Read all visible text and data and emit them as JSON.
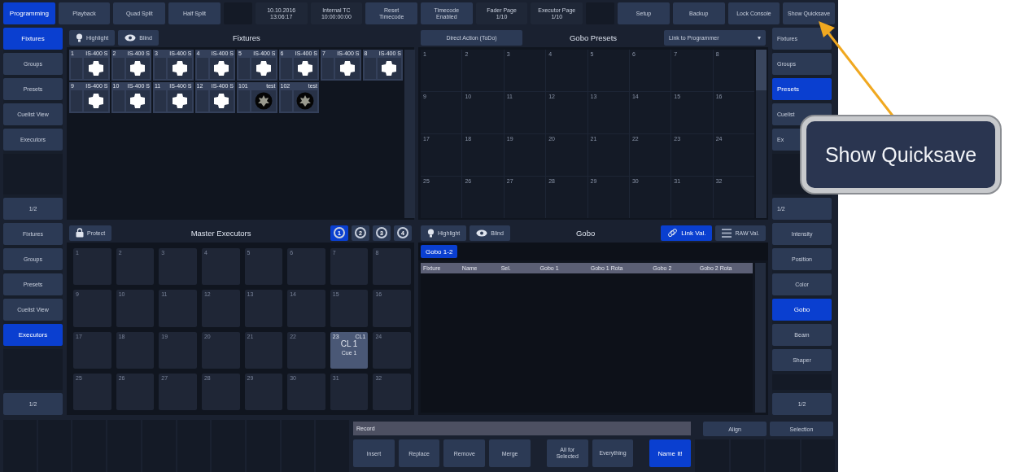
{
  "top_bar": [
    {
      "kind": "button",
      "label": "Programming",
      "selected": true
    },
    {
      "kind": "button",
      "label": "Playback",
      "selected": false
    },
    {
      "kind": "button",
      "label": "Quad Split",
      "selected": false
    },
    {
      "kind": "button",
      "label": "Half Split",
      "selected": false
    },
    {
      "kind": "blank"
    },
    {
      "kind": "info",
      "lines": [
        "10.10.2016",
        "13:06:17"
      ]
    },
    {
      "kind": "info",
      "lines": [
        "Internal TC",
        "10:00:00:00"
      ]
    },
    {
      "kind": "button",
      "lines": [
        "Reset",
        "Timecode"
      ],
      "selected": false
    },
    {
      "kind": "button",
      "lines": [
        "Timecode",
        "Enabled"
      ],
      "selected": false
    },
    {
      "kind": "info",
      "lines": [
        "Fader Page",
        "1/10"
      ]
    },
    {
      "kind": "info",
      "lines": [
        "Executor Page",
        "1/10"
      ]
    },
    {
      "kind": "blank"
    },
    {
      "kind": "button",
      "label": "Setup",
      "selected": false
    },
    {
      "kind": "button",
      "label": "Backup",
      "selected": false
    },
    {
      "kind": "button",
      "label": "Lock Console",
      "selected": false
    },
    {
      "kind": "button",
      "label": "Show Quicksave",
      "selected": false
    }
  ],
  "upper_left_sidebar": {
    "items": [
      {
        "label": "Fixtures",
        "selected": true
      },
      {
        "label": "Groups",
        "selected": false
      },
      {
        "label": "Presets",
        "selected": false
      },
      {
        "label": "Cuelist View",
        "selected": false
      },
      {
        "label": "Executors",
        "selected": false
      }
    ],
    "page": "1/2"
  },
  "fixtures_panel": {
    "title": "Fixtures",
    "highlight": "Highlight",
    "blind": "Blind",
    "fixtures": [
      {
        "number": "1",
        "type": "IS-400 S",
        "kind": "open"
      },
      {
        "number": "2",
        "type": "IS-400 S",
        "kind": "open"
      },
      {
        "number": "3",
        "type": "IS-400 S",
        "kind": "open"
      },
      {
        "number": "4",
        "type": "IS-400 S",
        "kind": "open"
      },
      {
        "number": "5",
        "type": "IS-400 S",
        "kind": "open"
      },
      {
        "number": "6",
        "type": "IS-400 S",
        "kind": "open"
      },
      {
        "number": "7",
        "type": "IS-400 S",
        "kind": "open"
      },
      {
        "number": "8",
        "type": "IS-400 S",
        "kind": "open"
      },
      {
        "number": "9",
        "type": "IS-400 S",
        "kind": "open"
      },
      {
        "number": "10",
        "type": "IS-400 S",
        "kind": "open"
      },
      {
        "number": "11",
        "type": "IS-400 S",
        "kind": "open"
      },
      {
        "number": "12",
        "type": "IS-400 S",
        "kind": "open"
      },
      {
        "number": "101",
        "type": "test",
        "kind": "pattern"
      },
      {
        "number": "102",
        "type": "test",
        "kind": "pattern"
      }
    ]
  },
  "gobo_presets_panel": {
    "title": "Gobo Presets",
    "action": "Direct Action (ToDo)",
    "link_dropdown": "Link to Programmer",
    "caret": "▾",
    "cells": [
      "1",
      "2",
      "3",
      "4",
      "5",
      "6",
      "7",
      "8",
      "9",
      "10",
      "11",
      "12",
      "13",
      "14",
      "15",
      "16",
      "17",
      "18",
      "19",
      "20",
      "21",
      "22",
      "23",
      "24",
      "25",
      "26",
      "27",
      "28",
      "29",
      "30",
      "31",
      "32"
    ]
  },
  "upper_right_sidebar": {
    "items": [
      {
        "label": "Fixtures",
        "selected": false
      },
      {
        "label": "Groups",
        "selected": false
      },
      {
        "label": "Presets",
        "selected": true
      },
      {
        "label": "Cuelist",
        "selected": false
      },
      {
        "label": "Ex",
        "selected": false
      }
    ],
    "page": "1/2"
  },
  "lower_left_sidebar": {
    "items": [
      {
        "label": "Fixtures",
        "selected": false
      },
      {
        "label": "Groups",
        "selected": false
      },
      {
        "label": "Presets",
        "selected": false
      },
      {
        "label": "Cuelist View",
        "selected": false
      },
      {
        "label": "Executors",
        "selected": true
      }
    ],
    "page": "1/2"
  },
  "master_executors_panel": {
    "title": "Master Executors",
    "protect": "Protect",
    "pages": [
      {
        "label": "1",
        "selected": true
      },
      {
        "label": "2",
        "selected": false
      },
      {
        "label": "3",
        "selected": false
      },
      {
        "label": "4",
        "selected": false
      }
    ],
    "executors": [
      {
        "kind": "empty",
        "number": "1"
      },
      {
        "kind": "empty",
        "number": "2"
      },
      {
        "kind": "empty",
        "number": "3"
      },
      {
        "kind": "empty",
        "number": "4"
      },
      {
        "kind": "empty",
        "number": "5"
      },
      {
        "kind": "empty",
        "number": "6"
      },
      {
        "kind": "empty",
        "number": "7"
      },
      {
        "kind": "empty",
        "number": "8"
      },
      {
        "kind": "empty",
        "number": "9"
      },
      {
        "kind": "empty",
        "number": "10"
      },
      {
        "kind": "empty",
        "number": "11"
      },
      {
        "kind": "empty",
        "number": "12"
      },
      {
        "kind": "empty",
        "number": "13"
      },
      {
        "kind": "empty",
        "number": "14"
      },
      {
        "kind": "empty",
        "number": "15"
      },
      {
        "kind": "empty",
        "number": "16"
      },
      {
        "kind": "empty",
        "number": "17"
      },
      {
        "kind": "empty",
        "number": "18"
      },
      {
        "kind": "empty",
        "number": "19"
      },
      {
        "kind": "empty",
        "number": "20"
      },
      {
        "kind": "empty",
        "number": "21"
      },
      {
        "kind": "empty",
        "number": "22"
      },
      {
        "kind": "cuelist",
        "number": "23",
        "tag": "CL1",
        "name": "CL 1",
        "cue": "Cue 1"
      },
      {
        "kind": "empty",
        "number": "24"
      },
      {
        "kind": "empty",
        "number": "25"
      },
      {
        "kind": "empty",
        "number": "26"
      },
      {
        "kind": "empty",
        "number": "27"
      },
      {
        "kind": "empty",
        "number": "28"
      },
      {
        "kind": "empty",
        "number": "29"
      },
      {
        "kind": "empty",
        "number": "30"
      },
      {
        "kind": "empty",
        "number": "31"
      },
      {
        "kind": "empty",
        "number": "32"
      }
    ]
  },
  "gobo_panel": {
    "title": "Gobo",
    "highlight": "Highlight",
    "blind": "Blind",
    "link_values": {
      "label": "Link Val.",
      "selected": true
    },
    "raw_values": {
      "label": "RAW Val.",
      "selected": false
    },
    "tabs": [
      {
        "label": "Gobo 1-2",
        "selected": true
      }
    ],
    "columns": [
      "Fixture",
      "Name",
      "Sel.",
      "Gobo 1",
      "Gobo 1 Rota",
      "Gobo 2",
      "Gobo 2 Rota"
    ]
  },
  "lower_right_sidebar": {
    "items": [
      {
        "label": "Intensity",
        "selected": false
      },
      {
        "label": "Position",
        "selected": false
      },
      {
        "label": "Color",
        "selected": false
      },
      {
        "label": "Gobo",
        "selected": true
      },
      {
        "label": "Beam",
        "selected": false
      },
      {
        "label": "Shaper",
        "selected": false
      }
    ],
    "page": "1/2"
  },
  "bottom_bar": {
    "record_field": "Record",
    "record_buttons": [
      {
        "label": "Insert",
        "selected": false
      },
      {
        "label": "Replace",
        "selected": false
      },
      {
        "label": "Remove",
        "selected": false
      },
      {
        "label": "Merge",
        "selected": false
      }
    ],
    "store_buttons": [
      {
        "lines": [
          "All for",
          "Selected"
        ],
        "selected": false
      },
      {
        "lines": [
          "Everything"
        ],
        "selected": false
      }
    ],
    "name_button": {
      "label": "Name It!",
      "selected": true
    },
    "right_buttons": [
      "Align",
      "Selection"
    ]
  },
  "callout": {
    "label": "Show Quicksave"
  }
}
